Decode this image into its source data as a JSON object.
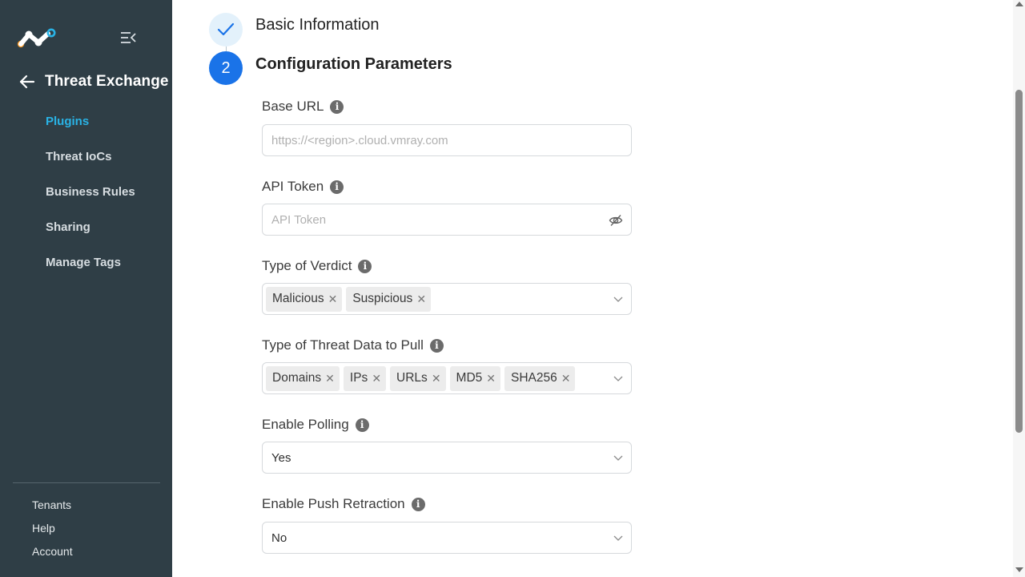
{
  "sidebar": {
    "back_title": "Threat Exchange",
    "nav": [
      {
        "label": "Plugins",
        "active": true
      },
      {
        "label": "Threat IoCs"
      },
      {
        "label": "Business Rules"
      },
      {
        "label": "Sharing"
      },
      {
        "label": "Manage Tags"
      }
    ],
    "bottom": [
      "Tenants",
      "Help",
      "Account"
    ]
  },
  "steps": [
    {
      "number": "1",
      "label": "Basic Information",
      "state": "completed"
    },
    {
      "number": "2",
      "label": "Configuration Parameters",
      "state": "active"
    }
  ],
  "form": {
    "base_url": {
      "label": "Base URL",
      "placeholder": "https://<region>.cloud.vmray.com"
    },
    "api_token": {
      "label": "API Token",
      "placeholder": "API Token"
    },
    "type_of_verdict": {
      "label": "Type of Verdict",
      "tags": [
        "Malicious",
        "Suspicious"
      ]
    },
    "threat_data": {
      "label": "Type of Threat Data to Pull",
      "tags": [
        "Domains",
        "IPs",
        "URLs",
        "MD5",
        "SHA256"
      ]
    },
    "enable_polling": {
      "label": "Enable Polling",
      "value": "Yes"
    },
    "enable_push_retraction": {
      "label": "Enable Push Retraction",
      "value": "No"
    }
  },
  "colors": {
    "sidebar_bg": "#2f3e46",
    "active_nav": "#29b3e6",
    "step_active": "#1a73e8",
    "logo_orange": "#f7941d",
    "logo_blue": "#29b3e6"
  }
}
